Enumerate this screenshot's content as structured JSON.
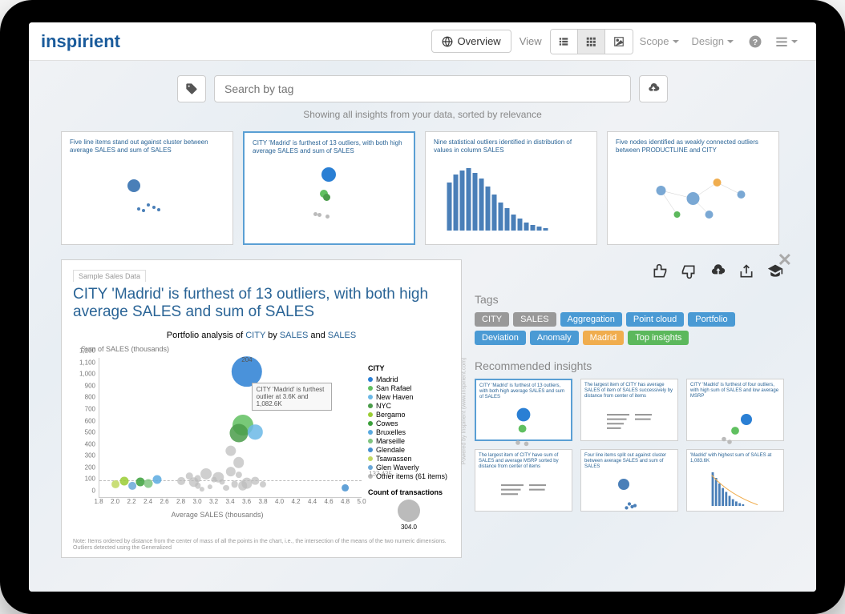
{
  "logo": "inspirient",
  "topbar": {
    "overview_label": "Overview",
    "view_label": "View",
    "scope_label": "Scope",
    "design_label": "Design"
  },
  "search": {
    "placeholder": "Search by tag",
    "subtext": "Showing all insights from your data, sorted by relevance"
  },
  "thumbs": [
    {
      "title": "Five line items stand out against cluster between average SALES and sum of SALES"
    },
    {
      "title": "CITY 'Madrid' is furthest of 13 outliers, with both high average SALES and sum of SALES"
    },
    {
      "title": "Nine statistical outliers identified in distribution of values in column SALES"
    },
    {
      "title": "Five nodes identified as weakly connected outliers between PRODUCTLINE and CITY"
    }
  ],
  "detail": {
    "sample_tab": "Sample Sales Data",
    "title_pre": "CITY 'Madrid' is furthest of 13 outliers, with both high average ",
    "title_post": "SALES and sum of SALES",
    "chart_title_pre": "Portfolio analysis of ",
    "chart_title_parts": {
      "city": "CITY",
      "by": " by ",
      "sales1": "SALES",
      "and": " and ",
      "sales2": "SALES"
    },
    "y_label": "Sum of SALES (thousands)",
    "x_label": "Average SALES (thousands)",
    "annotation": "CITY 'Madrid' is furthest outlier at 3.6K and 1,082.6K",
    "dashed_label": "137.435",
    "legend_title": "CITY",
    "legend": [
      {
        "name": "Madrid",
        "color": "#2a7fd4"
      },
      {
        "name": "San Rafael",
        "color": "#60c060"
      },
      {
        "name": "New Haven",
        "color": "#6bb8e6"
      },
      {
        "name": "NYC",
        "color": "#4a9c4a"
      },
      {
        "name": "Bergamo",
        "color": "#9acd32"
      },
      {
        "name": "Cowes",
        "color": "#3aa03a"
      },
      {
        "name": "Bruxelles",
        "color": "#5aaae0"
      },
      {
        "name": "Marseille",
        "color": "#7fc47f"
      },
      {
        "name": "Glendale",
        "color": "#4590d0"
      },
      {
        "name": "Tsawassen",
        "color": "#c0d860"
      },
      {
        "name": "Glen Waverly",
        "color": "#6aa8d8"
      },
      {
        "name": "Other items (61 items)",
        "color": "#bbb"
      }
    ],
    "count_title": "Count of transactions",
    "count_value": "304.0",
    "footnote": "Note: Items ordered by distance from the center of mass of all the points in the chart, i.e., the intersection of the means of the two numeric dimensions. Outliers detected using the Generalized"
  },
  "chart_data": {
    "type": "scatter",
    "title": "Portfolio analysis of CITY by SALES and SALES",
    "xlabel": "Average SALES (thousands)",
    "ylabel": "Sum of SALES (thousands)",
    "xlim": [
      1.8,
      5.0
    ],
    "ylim": [
      0,
      1200
    ],
    "y_ticks": [
      0,
      100,
      200,
      300,
      400,
      500,
      600,
      700,
      800,
      900,
      1000,
      1100,
      1200
    ],
    "x_ticks": [
      1.8,
      2.0,
      2.2,
      2.4,
      2.6,
      2.8,
      3.0,
      3.2,
      3.4,
      3.6,
      3.8,
      4.0,
      4.2,
      4.4,
      4.6,
      4.8,
      5.0
    ],
    "reference_y": 137.435,
    "series": [
      {
        "name": "Madrid",
        "x": 3.6,
        "y": 1082.6,
        "size": 304,
        "color": "#2a7fd4",
        "label": "204"
      },
      {
        "name": "San Rafael",
        "x": 3.55,
        "y": 620,
        "size": 140,
        "color": "#60c060"
      },
      {
        "name": "NYC",
        "x": 3.5,
        "y": 550,
        "size": 110,
        "color": "#4a9c4a"
      },
      {
        "name": "New Haven",
        "x": 3.7,
        "y": 560,
        "size": 70,
        "color": "#6bb8e6"
      },
      {
        "name": "Bergamo",
        "x": 2.1,
        "y": 140,
        "size": 25,
        "color": "#9acd32"
      },
      {
        "name": "Cowes",
        "x": 2.3,
        "y": 130,
        "size": 25,
        "color": "#3aa03a"
      },
      {
        "name": "Bruxelles",
        "x": 2.5,
        "y": 150,
        "size": 25,
        "color": "#5aaae0"
      },
      {
        "name": "Marseille",
        "x": 2.4,
        "y": 120,
        "size": 25,
        "color": "#7fc47f"
      },
      {
        "name": "Glendale",
        "x": 4.8,
        "y": 80,
        "size": 20,
        "color": "#4590d0"
      },
      {
        "name": "Tsawassen",
        "x": 2.0,
        "y": 110,
        "size": 20,
        "color": "#c0d860"
      },
      {
        "name": "Glen Waverly",
        "x": 2.2,
        "y": 100,
        "size": 20,
        "color": "#6aa8d8"
      }
    ],
    "other_points": [
      {
        "x": 2.8,
        "y": 140
      },
      {
        "x": 2.9,
        "y": 180
      },
      {
        "x": 3.0,
        "y": 160
      },
      {
        "x": 3.1,
        "y": 200
      },
      {
        "x": 3.2,
        "y": 150
      },
      {
        "x": 3.3,
        "y": 130
      },
      {
        "x": 3.4,
        "y": 220
      },
      {
        "x": 3.5,
        "y": 190
      },
      {
        "x": 3.6,
        "y": 120
      },
      {
        "x": 3.7,
        "y": 140
      },
      {
        "x": 3.8,
        "y": 110
      },
      {
        "x": 3.0,
        "y": 100
      },
      {
        "x": 3.15,
        "y": 90
      },
      {
        "x": 3.25,
        "y": 170
      },
      {
        "x": 3.35,
        "y": 80
      },
      {
        "x": 3.45,
        "y": 110
      },
      {
        "x": 3.55,
        "y": 100
      },
      {
        "x": 2.95,
        "y": 130
      },
      {
        "x": 3.05,
        "y": 70
      },
      {
        "x": 3.4,
        "y": 400
      },
      {
        "x": 3.5,
        "y": 300
      }
    ]
  },
  "side": {
    "tags_label": "Tags",
    "tags": [
      {
        "label": "CITY",
        "cls": "tag-gray"
      },
      {
        "label": "SALES",
        "cls": "tag-gray"
      },
      {
        "label": "Aggregation",
        "cls": "tag-blue"
      },
      {
        "label": "Point cloud",
        "cls": "tag-blue"
      },
      {
        "label": "Portfolio",
        "cls": "tag-blue"
      },
      {
        "label": "Deviation",
        "cls": "tag-blue"
      },
      {
        "label": "Anomaly",
        "cls": "tag-blue"
      },
      {
        "label": "Madrid",
        "cls": "tag-orange"
      },
      {
        "label": "Top insights",
        "cls": "tag-green"
      }
    ],
    "rec_label": "Recommended insights",
    "recs": [
      {
        "title": "CITY 'Madrid' is furthest of 13 outliers, with both high average SALES and sum of SALES"
      },
      {
        "title": "The largest item of CITY has average SALES of item of SALES successively by distance from center of items"
      },
      {
        "title": "CITY 'Madrid' is furthest of four outliers, with high sum of SALES and low average MSRP"
      },
      {
        "title": "The largest item of CITY have sum of SALES and average MSRP sorted by distance from center of items"
      },
      {
        "title": "Four line items split out against cluster between average SALES and sum of SALES"
      },
      {
        "title": "'Madrid' with highest sum of SALES at 1,083.6K"
      }
    ]
  },
  "powered": "Powered by Inspirient (www.inspirient.com)"
}
